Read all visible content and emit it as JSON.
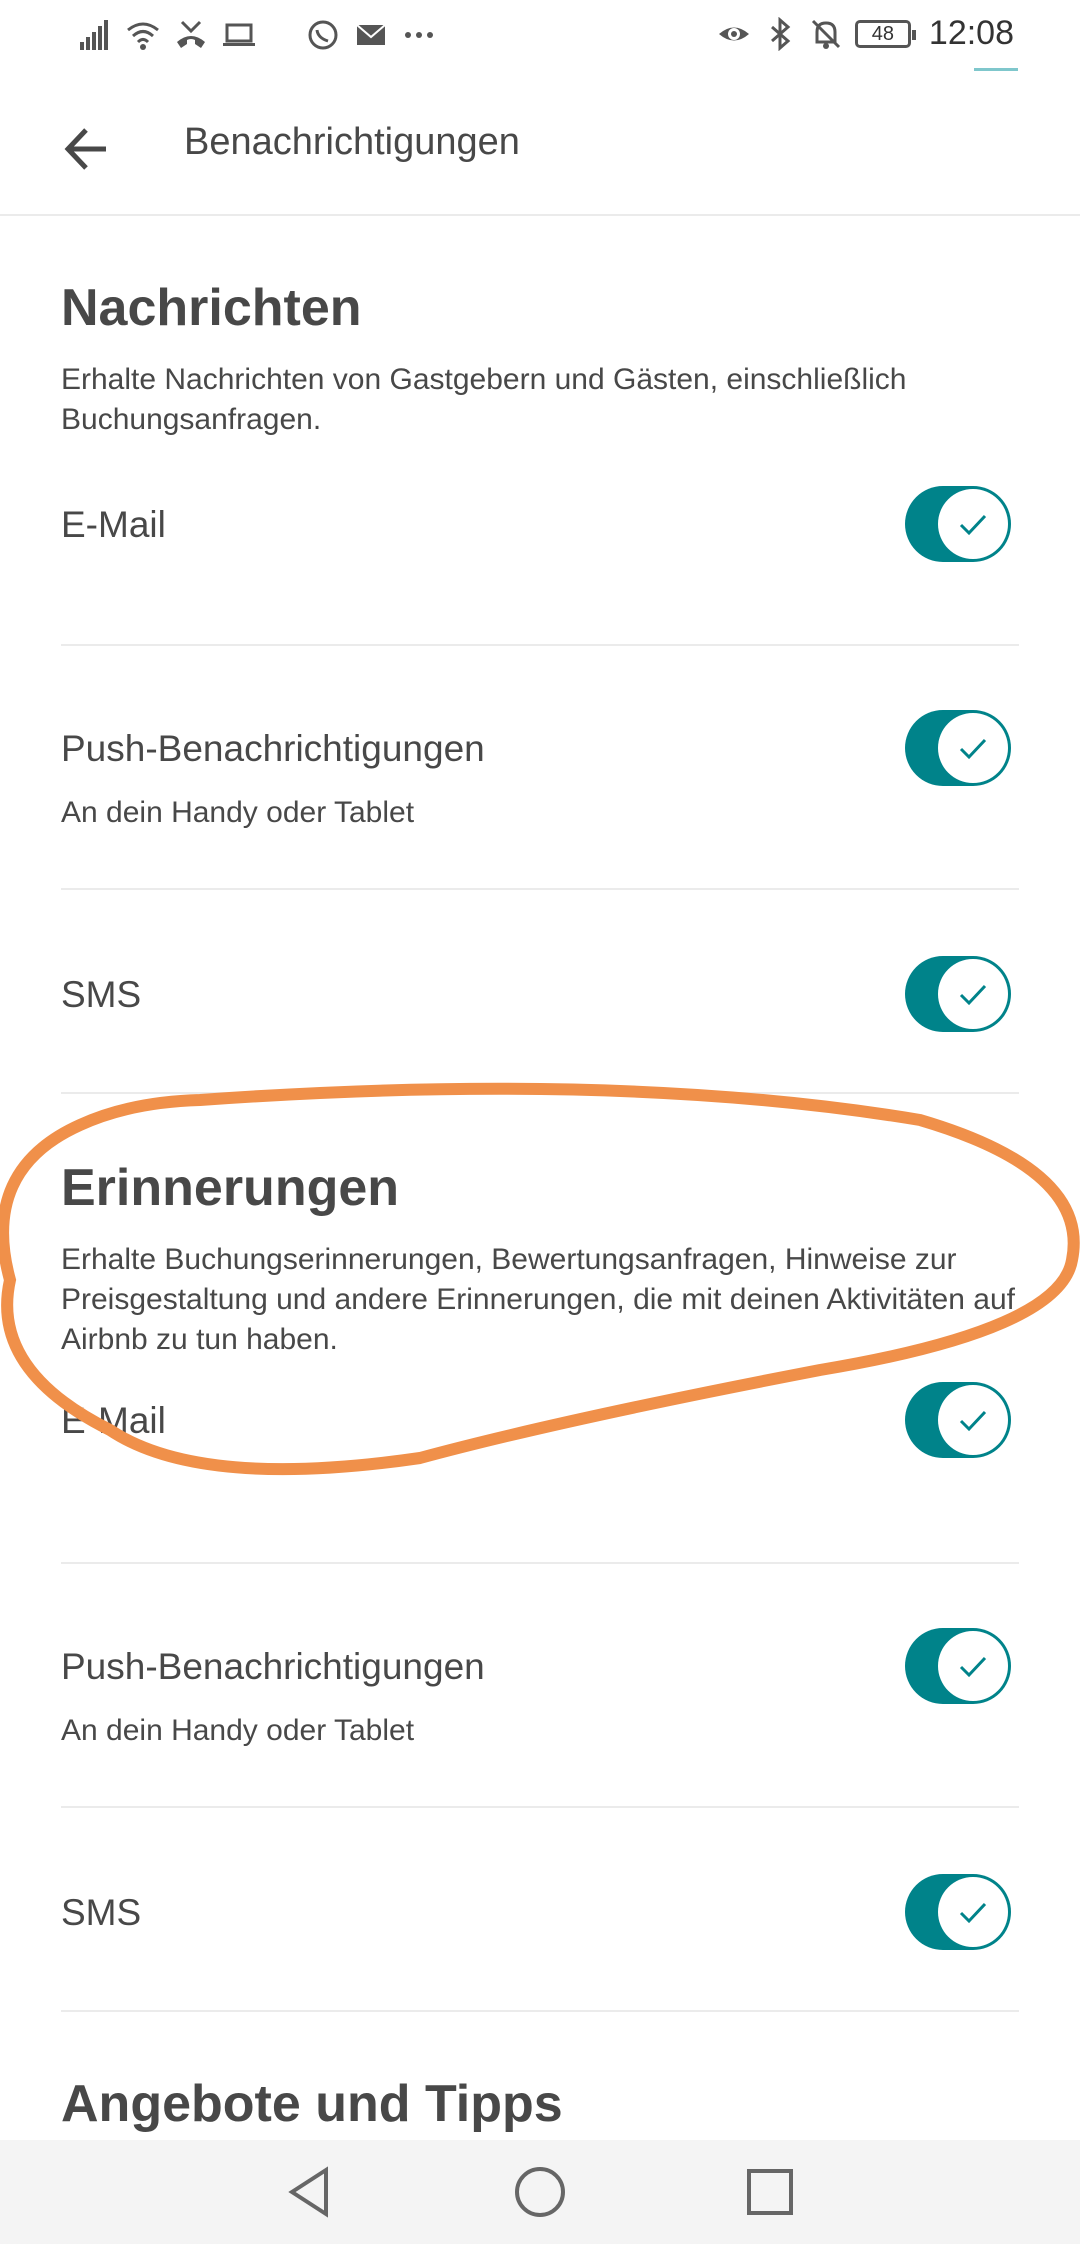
{
  "status_bar": {
    "battery": "48",
    "time": "12:08",
    "icons_left": [
      "signal-icon",
      "wifi-icon",
      "missed-call-icon",
      "laptop-icon",
      "whatsapp-icon",
      "mail-icon",
      "more-icon"
    ],
    "icons_right": [
      "eye-icon",
      "bluetooth-icon",
      "mute-icon",
      "battery-icon"
    ]
  },
  "header": {
    "title": "Benachrichtigungen",
    "back_icon": "arrow-left-icon"
  },
  "sections": {
    "messages": {
      "title": "Nachrichten",
      "description": "Erhalte Nachrichten von Gastgebern und Gästen, einschließlich Buchungsanfragen.",
      "rows": [
        {
          "label": "E-Mail",
          "sub": "",
          "enabled": true
        },
        {
          "label": "Push-Benachrichtigungen",
          "sub": "An dein Handy oder Tablet",
          "enabled": true
        },
        {
          "label": "SMS",
          "sub": "",
          "enabled": true
        }
      ]
    },
    "reminders": {
      "title": "Erinnerungen",
      "description": "Erhalte Buchungserinnerungen, Bewertungsanfragen, Hinweise zur Preisgestaltung und andere Erinnerungen, die mit deinen Aktivitäten auf Airbnb zu tun haben.",
      "rows": [
        {
          "label": "E-Mail",
          "sub": "",
          "enabled": true
        },
        {
          "label": "Push-Benachrichtigungen",
          "sub": "An dein Handy oder Tablet",
          "enabled": true
        },
        {
          "label": "SMS",
          "sub": "",
          "enabled": true
        }
      ]
    },
    "offers": {
      "title": "Angebote und Tipps"
    }
  },
  "colors": {
    "toggle_on": "#00838a",
    "highlight": "#f0904a",
    "text": "#484848",
    "divider": "#ebebeb"
  }
}
